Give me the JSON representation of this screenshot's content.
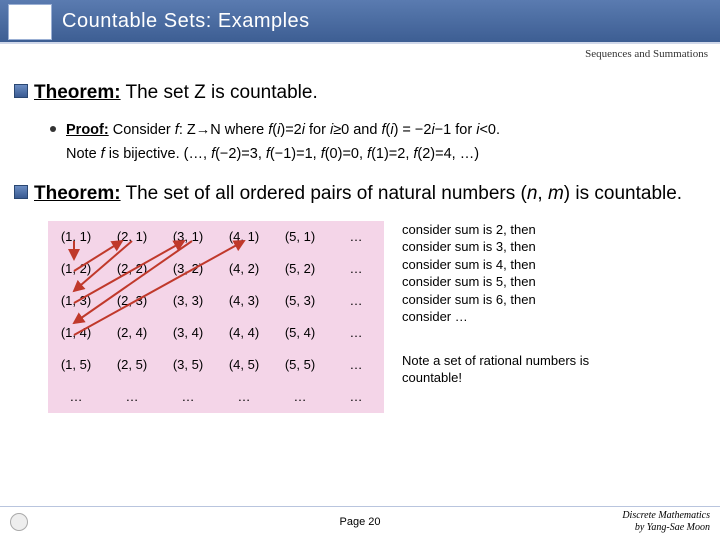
{
  "header": {
    "title": "Countable Sets: Examples",
    "subtitle": "Sequences and Summations"
  },
  "theorem1": {
    "label": "Theorem:",
    "text": " The set Z is countable."
  },
  "proof1": {
    "label": "Proof:",
    "line1a": " Consider ",
    "line1b": "f",
    "line1c": ": Z→N where ",
    "line1d": "f",
    "line1e": "(",
    "line1f": "i",
    "line1g": ")=2",
    "line1h": "i",
    "line1i": " for ",
    "line1j": "i",
    "line1k": "≥0 and ",
    "line1l": "f",
    "line1m": "(",
    "line1n": "i",
    "line1o": ") = −2",
    "line1p": "i",
    "line1q": "−1 for ",
    "line1r": "i",
    "line1s": "<0.",
    "line2a": "Note ",
    "line2b": "f",
    "line2c": " is bijective. (…, ",
    "line2d": "f",
    "line2e": "(−2)=3, ",
    "line2f": "f",
    "line2g": "(−1)=1, ",
    "line2h": "f",
    "line2i": "(0)=0, ",
    "line2j": "f",
    "line2k": "(1)=2, ",
    "line2l": "f",
    "line2m": "(2)=4, …)"
  },
  "theorem2": {
    "label": "Theorem:",
    "text_a": " The set of all ordered pairs of natural numbers (",
    "text_b": "n",
    "text_c": ", ",
    "text_d": "m",
    "text_e": ") is countable."
  },
  "grid": {
    "rows": [
      [
        "(1, 1)",
        "(2, 1)",
        "(3, 1)",
        "(4, 1)",
        "(5, 1)",
        "…"
      ],
      [
        "(1, 2)",
        "(2, 2)",
        "(3, 2)",
        "(4, 2)",
        "(5, 2)",
        "…"
      ],
      [
        "(1, 3)",
        "(2, 3)",
        "(3, 3)",
        "(4, 3)",
        "(5, 3)",
        "…"
      ],
      [
        "(1, 4)",
        "(2, 4)",
        "(3, 4)",
        "(4, 4)",
        "(5, 4)",
        "…"
      ],
      [
        "(1, 5)",
        "(2, 5)",
        "(3, 5)",
        "(4, 5)",
        "(5, 5)",
        "…"
      ],
      [
        "…",
        "…",
        "…",
        "…",
        "…",
        "…"
      ]
    ]
  },
  "side": {
    "note1": "consider sum is 2, then\nconsider sum is 3, then\nconsider sum is 4, then\nconsider sum is 5, then\nconsider sum is 6, then\nconsider …",
    "note2": "Note a set of rational numbers is countable!"
  },
  "footer": {
    "page": "Page 20",
    "credit1": "Discrete Mathematics",
    "credit2": "by Yang-Sae Moon"
  }
}
